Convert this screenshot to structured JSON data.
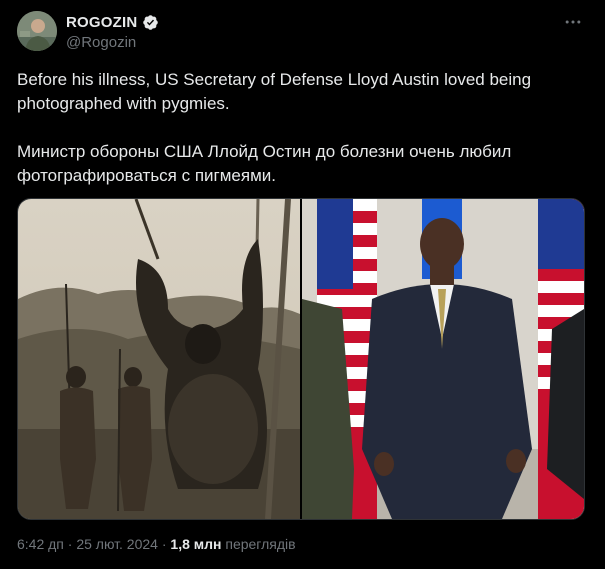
{
  "author": {
    "name": "ROGOZIN",
    "handle": "@Rogozin",
    "verified": true,
    "badge_color": "#1d9bf0"
  },
  "tweet": {
    "text_en": "Before his illness, US Secretary of Defense Lloyd Austin loved being photographed with pygmies.",
    "text_ru": "Министр обороны США Ллойд Остин до болезни очень любил фотографироваться с пигмеями."
  },
  "media": {
    "left_image": "vintage sepia photograph of two men holding spears beside a hanging gorilla",
    "right_image": "photograph of a man in a dark suit standing between US flags"
  },
  "meta": {
    "time": "6:42 дп",
    "separator": "·",
    "date": "25 лют. 2024",
    "views_count": "1,8 млн",
    "views_label": "переглядів"
  },
  "more_icon": "more-horizontal-icon",
  "colors": {
    "background": "#000000",
    "text": "#e7e9ea",
    "secondary": "#71767b",
    "border": "#2f3336"
  }
}
